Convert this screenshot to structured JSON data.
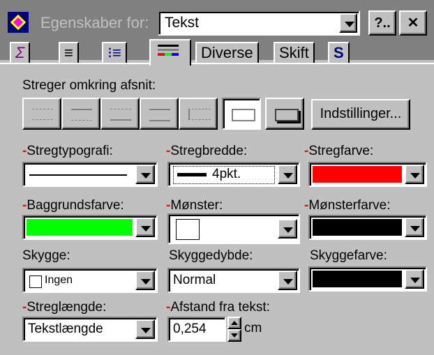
{
  "title_bar": {
    "label": "Egenskaber for:",
    "combo_value": "Tekst",
    "help_button": "?..",
    "close_button": "✕"
  },
  "tabs": [
    {
      "label": "Σ",
      "icon": "text-format-icon"
    },
    {
      "label": "≡",
      "icon": "paragraph-icon"
    },
    {
      "label": "⁝≡",
      "icon": "bullets-icon"
    },
    {
      "label": "▬",
      "icon": "border-icon",
      "active": true
    },
    {
      "label": "Diverse"
    },
    {
      "label": "Skift"
    },
    {
      "label": "S",
      "icon": "style-icon"
    }
  ],
  "border_section": {
    "label": "Streger omkring afsnit:",
    "settings_button": "Indstillinger..."
  },
  "fields": {
    "line_typography": {
      "label": "Stregtypografi:"
    },
    "line_width": {
      "label": "Stregbredde:",
      "value": "4pkt."
    },
    "line_color": {
      "label": "Stregfarve:",
      "color": "#ff0000"
    },
    "background_color": {
      "label": "Baggrundsfarve:",
      "color": "#00ff00"
    },
    "pattern": {
      "label": "Mønster:"
    },
    "pattern_color": {
      "label": "Mønsterfarve:",
      "color": "#000000"
    },
    "shadow": {
      "label": "Skygge:",
      "value": "Ingen"
    },
    "shadow_depth": {
      "label": "Skyggedybde:",
      "value": "Normal"
    },
    "shadow_color": {
      "label": "Skyggefarve:",
      "color": "#000000"
    },
    "line_length": {
      "label": "Streglængde:",
      "value": "Tekstlængde"
    },
    "distance_from_text": {
      "label": "Afstand fra tekst:",
      "value": "0,254",
      "unit": "cm"
    }
  }
}
